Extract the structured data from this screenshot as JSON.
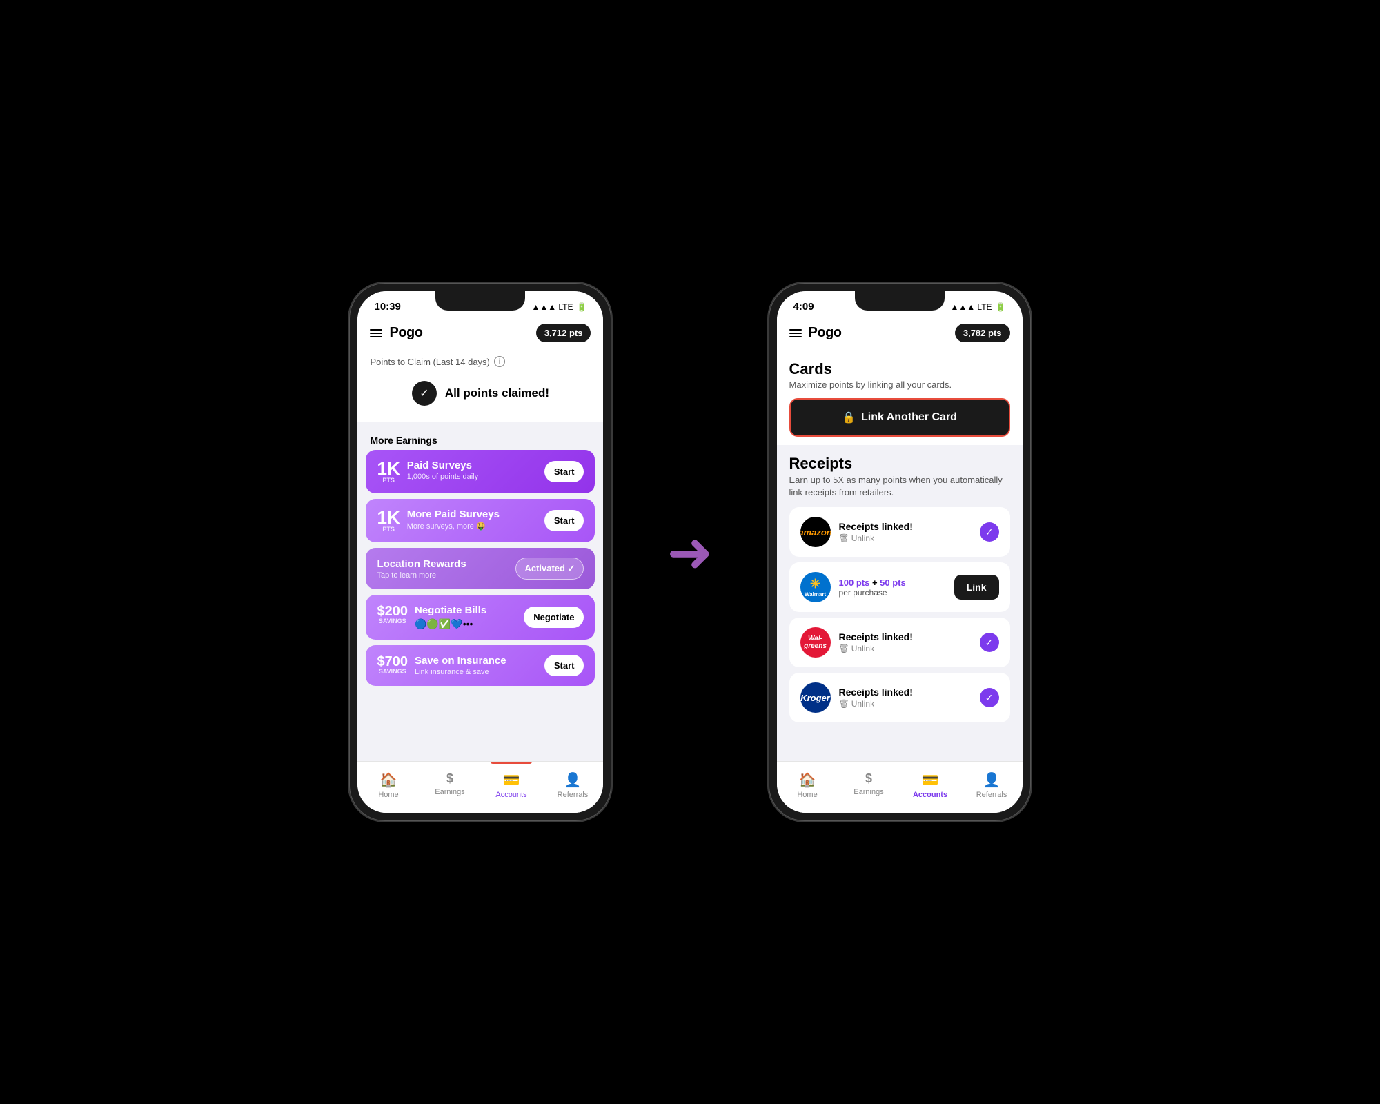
{
  "phone1": {
    "status": {
      "time": "10:39",
      "signal": "LTE",
      "battery": "■"
    },
    "header": {
      "logo": "Pogo",
      "points": "3,712 pts"
    },
    "points_section": {
      "label": "Points to Claim (Last 14 days)",
      "claimed_text": "All points claimed!"
    },
    "more_earnings": {
      "label": "More Earnings",
      "items": [
        {
          "amount": "1K",
          "unit": "PTS",
          "title": "Paid Surveys",
          "subtitle": "1,000s of points daily",
          "button": "Start"
        },
        {
          "amount": "1K",
          "unit": "PTS",
          "title": "More Paid Surveys",
          "subtitle": "More surveys, more 🤑",
          "button": "Start"
        },
        {
          "amount": null,
          "title": "Location Rewards",
          "subtitle": "Tap to learn more",
          "button": "Activated ✓"
        },
        {
          "amount": "$200",
          "unit": "SAVINGS",
          "title": "Negotiate Bills",
          "subtitle": "",
          "button": "Negotiate"
        },
        {
          "amount": "$700",
          "unit": "SAVINGS",
          "title": "Save on Insurance",
          "subtitle": "Link insurance & save",
          "button": "Start"
        }
      ]
    },
    "bottom_nav": [
      {
        "label": "Home",
        "icon": "🏠",
        "active": false
      },
      {
        "label": "Earnings",
        "icon": "$",
        "active": false
      },
      {
        "label": "Accounts",
        "icon": "💳",
        "active": true
      },
      {
        "label": "Referrals",
        "icon": "👤",
        "active": false
      }
    ]
  },
  "phone2": {
    "status": {
      "time": "4:09",
      "signal": "LTE",
      "battery": "■"
    },
    "header": {
      "logo": "Pogo",
      "points": "3,782 pts"
    },
    "cards_section": {
      "title": "Cards",
      "subtitle": "Maximize points by linking all your cards.",
      "link_button": "Link Another Card"
    },
    "receipts_section": {
      "title": "Receipts",
      "subtitle": "Earn up to 5X as many points when you automatically link receipts from retailers.",
      "items": [
        {
          "retailer": "amazon",
          "retailer_label": "amazon",
          "status": "Receipts linked!",
          "action": "Unlink",
          "linked": true
        },
        {
          "retailer": "walmart",
          "retailer_label": "Walmart",
          "status_pts": "100 pts + 50 pts",
          "status_sub": "per purchase",
          "action": "Link",
          "linked": false
        },
        {
          "retailer": "walgreens",
          "retailer_label": "Walgreens",
          "status": "Receipts linked!",
          "action": "Unlink",
          "linked": true
        },
        {
          "retailer": "kroger",
          "retailer_label": "Kroger",
          "status": "Receipts linked!",
          "action": "Unlink",
          "linked": true
        }
      ]
    },
    "bottom_nav": [
      {
        "label": "Home",
        "icon": "🏠",
        "active": false
      },
      {
        "label": "Earnings",
        "icon": "$",
        "active": false
      },
      {
        "label": "Accounts",
        "icon": "💳",
        "active": true
      },
      {
        "label": "Referrals",
        "icon": "👤",
        "active": false
      }
    ]
  },
  "arrow": "→"
}
